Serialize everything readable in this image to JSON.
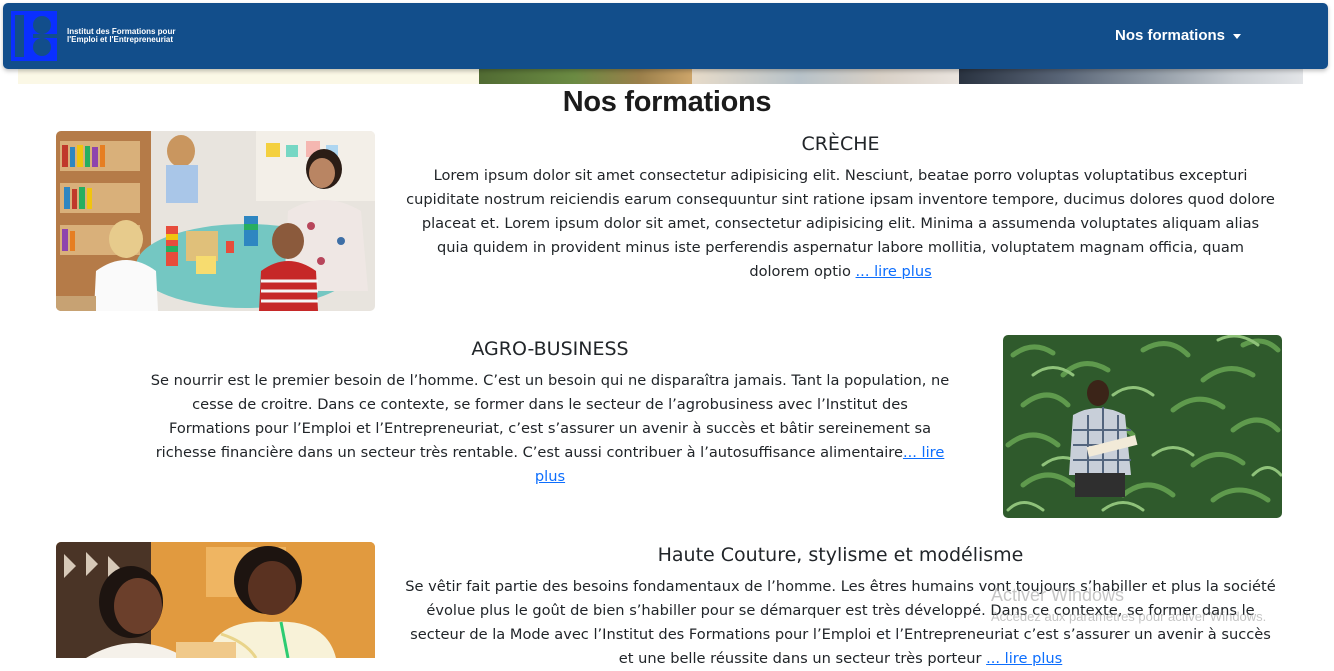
{
  "navbar": {
    "brand_line1": "Institut des Formations pour",
    "brand_line2": "l'Emploi et l'Entrepreneuriat",
    "dropdown_label": "Nos formations",
    "brand_color": "#124e8b"
  },
  "page": {
    "title": "Nos formations"
  },
  "formations": [
    {
      "title": "CRÈCHE",
      "text": "Lorem ipsum dolor sit amet consectetur adipisicing elit. Nesciunt, beatae porro voluptas voluptatibus excepturi cupiditate nostrum reiciendis earum consequuntur sint ratione ipsam inventore tempore, ducimus dolores quod dolore placeat et. Lorem ipsum dolor sit amet, consectetur adipisicing elit. Minima a assumenda voluptates aliquam alias quia quidem in provident minus iste perferendis aspernatur labore mollitia, voluptatem magnam officia, quam dolorem optio ",
      "link": "... lire plus"
    },
    {
      "title": "AGRO-BUSINESS",
      "text": "Se nourrir est le premier besoin de l’homme. C’est un besoin qui ne disparaîtra jamais. Tant la population, ne cesse de croitre. Dans ce contexte, se former dans le secteur de l’agrobusiness avec l’Institut des Formations pour l’Emploi et l’Entrepreneuriat, c’est s’assurer un avenir à succès et bâtir sereinement sa richesse financière dans un secteur très rentable. C’est aussi contribuer à l’autosuffisance alimentaire",
      "link": "... lire plus"
    },
    {
      "title": "Haute Couture, stylisme et modélisme",
      "text": "Se vêtir fait partie des besoins fondamentaux de l’homme. Les êtres humains vont toujours s’habiller et plus la société évolue plus le goût de bien s’habiller pour se démarquer est très développé. Dans ce contexte, se former dans le secteur de la Mode avec l’Institut des Formations pour l’Emploi et l’Entrepreneuriat c’est s’assurer un avenir à succès et une belle réussite dans un secteur très porteur ",
      "link": "... lire plus"
    }
  ],
  "watermark": {
    "title": "Activer Windows",
    "subtitle": "Accédez aux paramètres pour activer Windows."
  },
  "colors": {
    "link": "#0d6efd",
    "text": "#212529"
  }
}
